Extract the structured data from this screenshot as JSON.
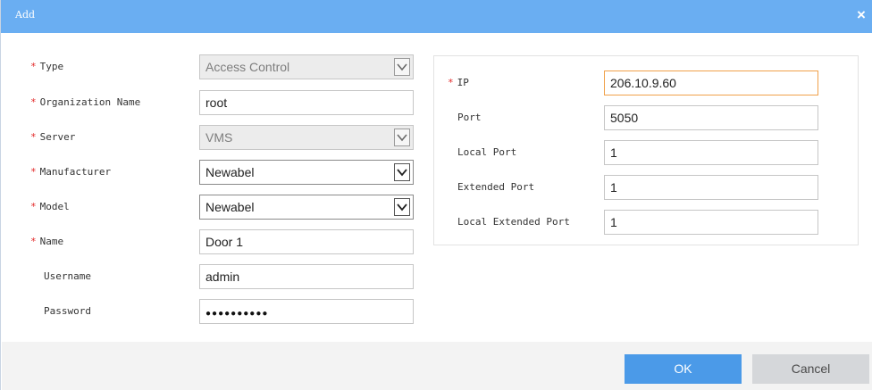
{
  "dialog": {
    "title": "Add",
    "close_glyph": "×"
  },
  "left_form": {
    "required_mark": "*",
    "type": {
      "label": "Type",
      "value": "Access Control"
    },
    "organization": {
      "label": "Organization Name",
      "value": "root"
    },
    "server": {
      "label": "Server",
      "value": "VMS"
    },
    "manufacturer": {
      "label": "Manufacturer",
      "value": "Newabel"
    },
    "model": {
      "label": "Model",
      "value": "Newabel"
    },
    "name": {
      "label": "Name",
      "value": "Door 1"
    },
    "username": {
      "label": "Username",
      "value": "admin"
    },
    "password": {
      "label": "Password",
      "masked_value": "●●●●●●●●●●"
    }
  },
  "right_form": {
    "ip": {
      "label": "IP",
      "value": "206.10.9.60"
    },
    "port": {
      "label": "Port",
      "value": "5050"
    },
    "local_port": {
      "label": "Local Port",
      "value": "1"
    },
    "extended_port": {
      "label": "Extended Port",
      "value": "1"
    },
    "local_extended_port": {
      "label": "Local Extended Port",
      "value": "1"
    }
  },
  "footer": {
    "ok_label": "OK",
    "cancel_label": "Cancel"
  },
  "colors": {
    "titlebar": "#6aaef2",
    "required": "#e32d2d",
    "ok_button": "#4b9ae8",
    "focus_border": "#f0a14a"
  },
  "icons": {
    "close": "close-icon",
    "dropdown": "chevron-down-icon"
  }
}
